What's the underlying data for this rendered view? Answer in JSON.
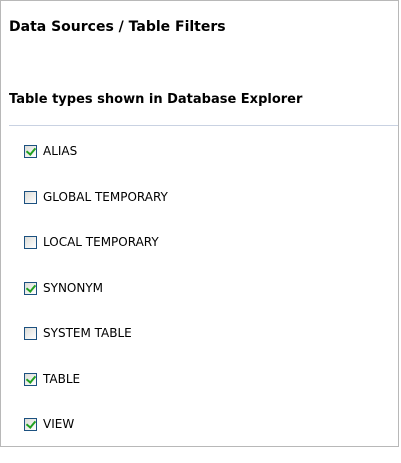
{
  "page_title": "Data Sources / Table Filters",
  "section_title": "Table types shown in Database Explorer",
  "table_types": [
    {
      "label": "ALIAS",
      "checked": true
    },
    {
      "label": "GLOBAL TEMPORARY",
      "checked": false
    },
    {
      "label": "LOCAL TEMPORARY",
      "checked": false
    },
    {
      "label": "SYNONYM",
      "checked": true
    },
    {
      "label": "SYSTEM TABLE",
      "checked": false
    },
    {
      "label": "TABLE",
      "checked": true
    },
    {
      "label": "VIEW",
      "checked": true
    }
  ],
  "colors": {
    "checkbox_border": "#1c5180",
    "checkmark": "#21a121",
    "section_rule": "#c9d2e2"
  }
}
